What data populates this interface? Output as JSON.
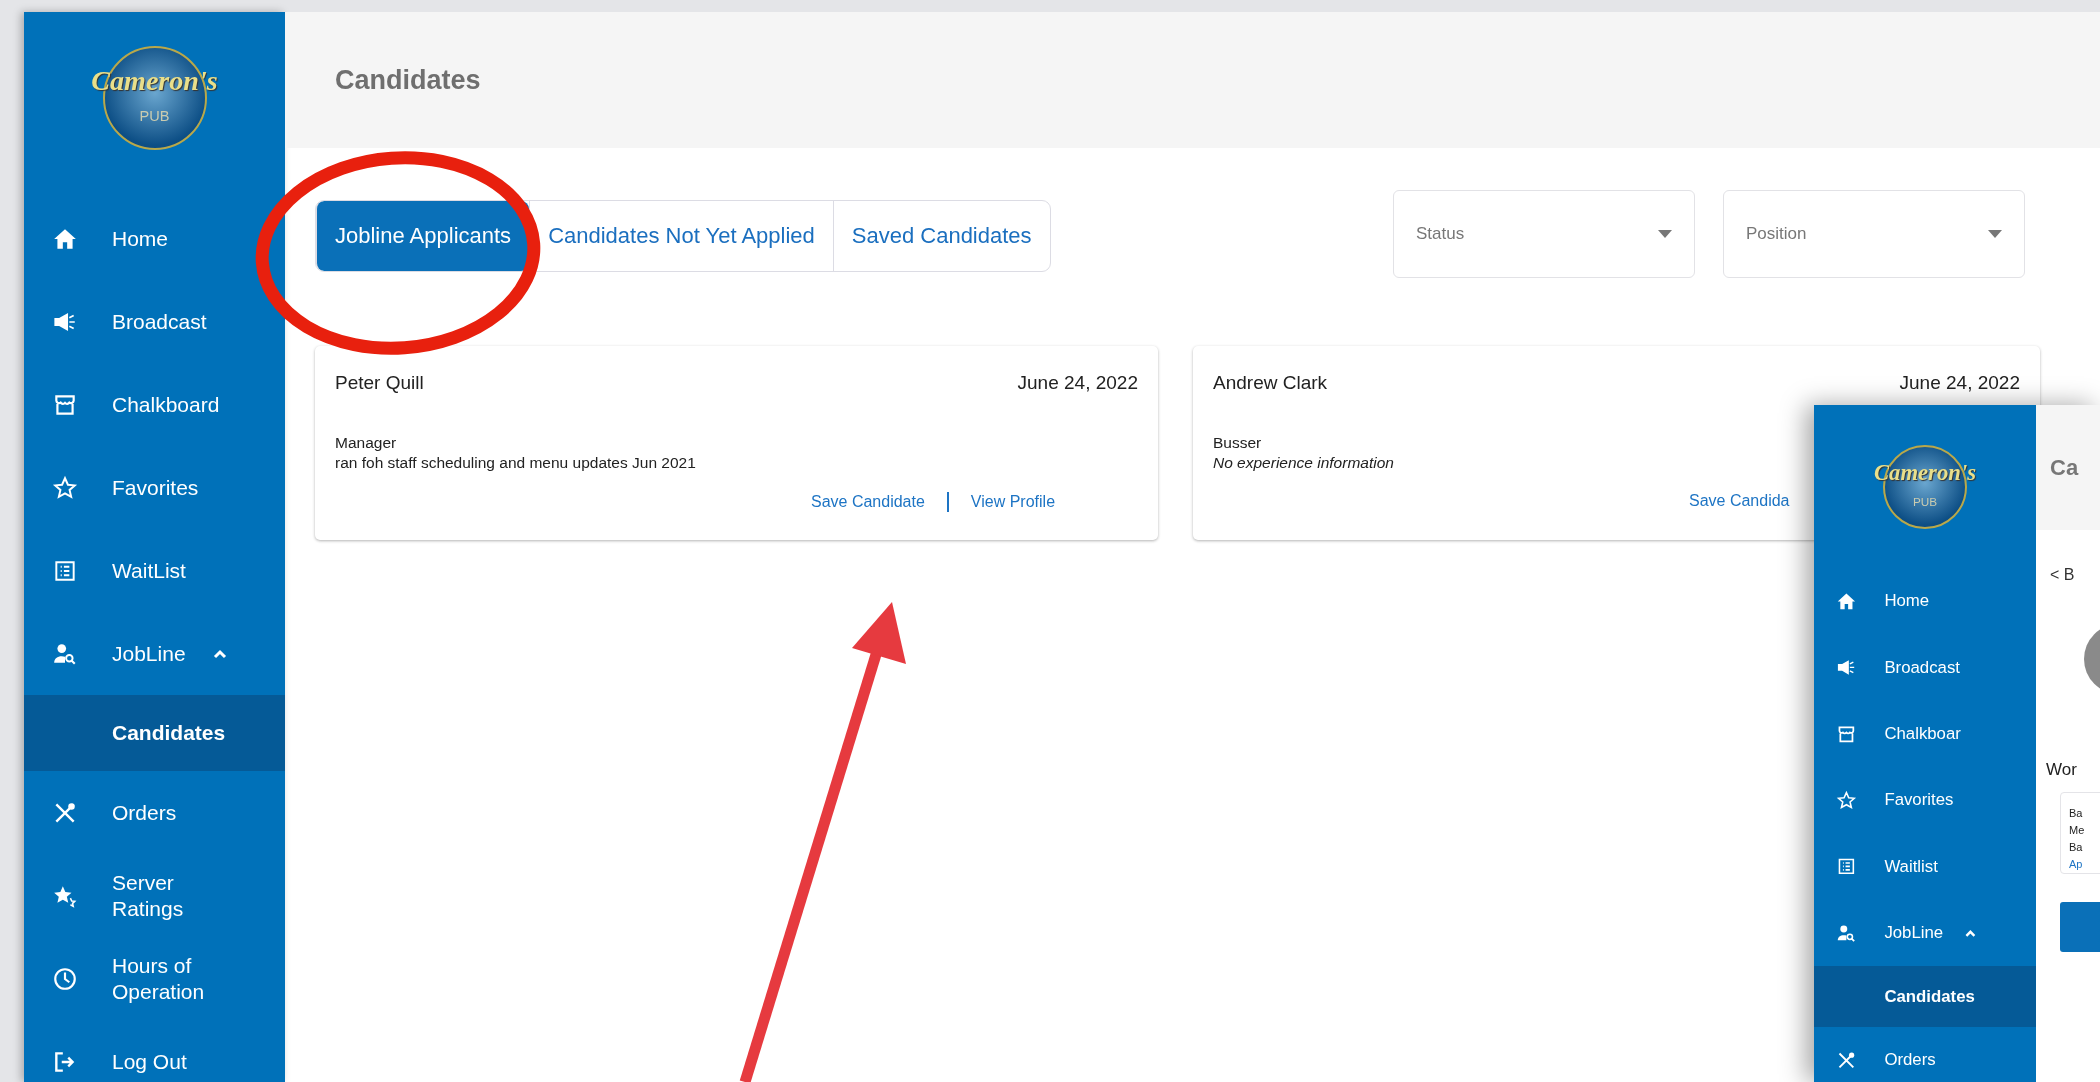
{
  "sidebar": {
    "logo": {
      "name": "Cameron's",
      "sub": "PUB"
    },
    "items": [
      {
        "label": "Home",
        "selected": false
      },
      {
        "label": "Broadcast",
        "selected": false
      },
      {
        "label": "Chalkboard",
        "selected": false
      },
      {
        "label": "Favorites",
        "selected": false
      },
      {
        "label": "WaitList",
        "selected": false
      },
      {
        "label": "JobLine",
        "selected": false,
        "expanded": true,
        "children": [
          {
            "label": "Candidates",
            "selected": true
          }
        ]
      },
      {
        "label": "Orders",
        "selected": false
      },
      {
        "label": "Server Ratings",
        "selected": false
      },
      {
        "label": "Hours of Operation",
        "selected": false
      },
      {
        "label": "Log Out",
        "selected": false
      }
    ]
  },
  "header": {
    "title": "Candidates"
  },
  "tabs": [
    {
      "label": "Jobline Applicants",
      "selected": true
    },
    {
      "label": "Candidates Not Yet Applied",
      "selected": false
    },
    {
      "label": "Saved Candidates",
      "selected": false
    }
  ],
  "filters": [
    {
      "placeholder": "Status"
    },
    {
      "placeholder": "Position"
    }
  ],
  "candidates": [
    {
      "name": "Peter Quill",
      "date": "June 24, 2022",
      "position": "Manager",
      "experience": "ran foh staff scheduling and menu updates  Jun 2021",
      "kind": "entry",
      "actions": [
        "Save Candidate",
        "View Profile"
      ]
    },
    {
      "name": "Andrew Clark",
      "date": "June 24, 2022",
      "position": "Busser",
      "experience": "No experience information",
      "kind": "none",
      "actions": [
        "Save Candida"
      ]
    }
  ],
  "inset": {
    "logo": {
      "name": "Cameron's",
      "sub": "PUB"
    },
    "items": [
      {
        "label": "Home",
        "selected": false
      },
      {
        "label": "Broadcast",
        "selected": false
      },
      {
        "label": "Chalkboar",
        "selected": false
      },
      {
        "label": "Favorites",
        "selected": false
      },
      {
        "label": "Waitlist",
        "selected": false
      },
      {
        "label": "JobLine",
        "selected": false,
        "expanded": true,
        "children": [
          {
            "label": "Candidates",
            "selected": true
          }
        ]
      },
      {
        "label": "Orders",
        "selected": false
      }
    ],
    "title": "Ca",
    "back": "< B",
    "section": "Wor",
    "lines": [
      "Ba",
      "Me",
      "Ba"
    ],
    "link": "Ap"
  }
}
